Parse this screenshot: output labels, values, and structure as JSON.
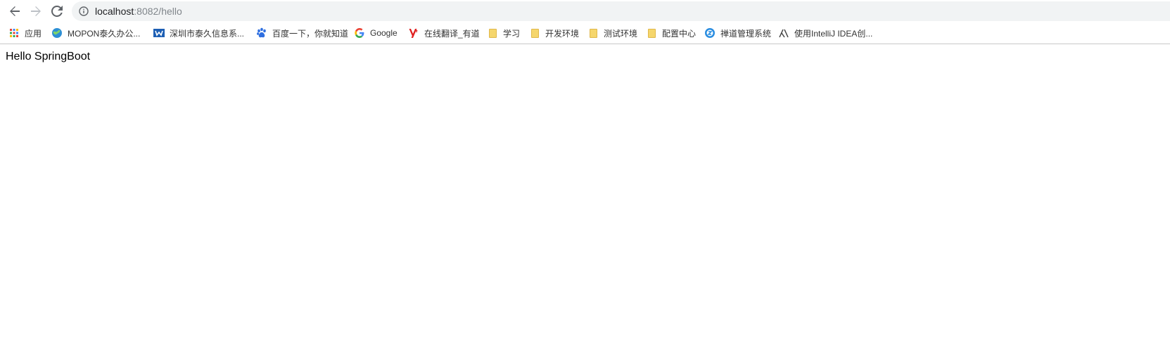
{
  "toolbar": {
    "url_host": "localhost",
    "url_rest": ":8082/hello"
  },
  "bookmarks": [
    {
      "label": "应用",
      "icon": "apps-grid-icon"
    },
    {
      "label": "MOPON泰久办公...",
      "icon": "globe-icon"
    },
    {
      "label": "深圳市泰久信息系...",
      "icon": "site-logo-icon"
    },
    {
      "label": "百度一下，你就知道",
      "icon": "baidu-paw-icon"
    },
    {
      "label": "Google",
      "icon": "google-g-icon"
    },
    {
      "label": "在线翻译_有道",
      "icon": "youdao-icon"
    },
    {
      "label": "学习",
      "icon": "folder-icon"
    },
    {
      "label": "开发环境",
      "icon": "folder-icon"
    },
    {
      "label": "测试环境",
      "icon": "folder-icon"
    },
    {
      "label": "配置中心",
      "icon": "folder-icon"
    },
    {
      "label": "禅道管理系统",
      "icon": "zentao-icon"
    },
    {
      "label": "使用IntelliJ IDEA创...",
      "icon": "lambda-icon"
    }
  ],
  "page": {
    "text": "Hello SpringBoot"
  },
  "colors": {
    "omnibox_bg": "#f1f3f4",
    "folder": "#f5d66d"
  }
}
